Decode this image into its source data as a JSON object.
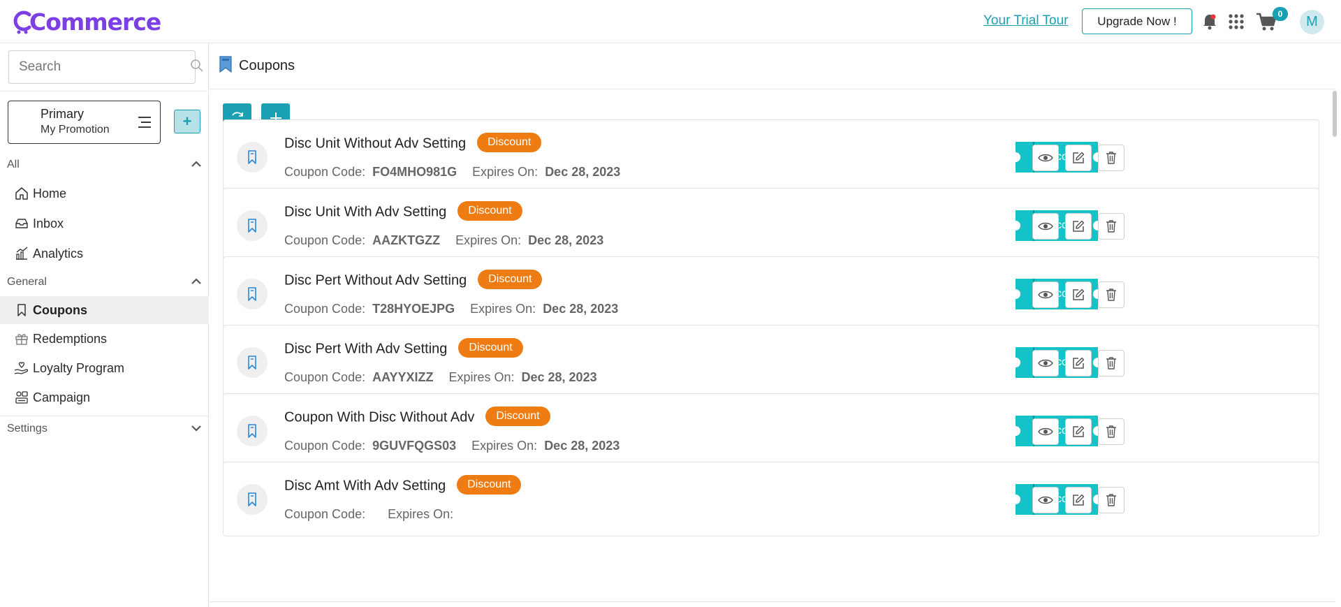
{
  "header": {
    "brand": "Commerce",
    "trial_link": "Your Trial Tour",
    "upgrade_label": "Upgrade Now !",
    "cart_count": "0",
    "avatar_initial": "M",
    "accent_color": "#1a9fb3",
    "brand_color": "#7b3fe4"
  },
  "sidebar": {
    "search_placeholder": "Search",
    "promotion": {
      "title": "Primary",
      "subtitle": "My Promotion",
      "add_label": "+"
    },
    "groups": [
      {
        "label": "All",
        "items": [
          {
            "label": "Home",
            "icon": "home-icon"
          },
          {
            "label": "Inbox",
            "icon": "inbox-icon"
          },
          {
            "label": "Analytics",
            "icon": "analytics-icon"
          }
        ]
      },
      {
        "label": "General",
        "items": [
          {
            "label": "Coupons",
            "icon": "bookmark-icon",
            "active": true
          },
          {
            "label": "Redemptions",
            "icon": "gift-icon"
          },
          {
            "label": "Loyalty Program",
            "icon": "hand-heart-icon"
          },
          {
            "label": "Campaign",
            "icon": "campaign-icon"
          }
        ]
      },
      {
        "label": "Settings",
        "items": []
      }
    ]
  },
  "main": {
    "title": "Coupons",
    "coupons": [
      {
        "name": "Disc Unit Without Adv Setting",
        "badge": "Discount",
        "code_label": "Coupon Code:",
        "code": "FO4MHO981G",
        "expires_label": "Expires On:",
        "expires": "Dec 28, 2023",
        "ticket_label": "Discount"
      },
      {
        "name": "Disc Unit With Adv Setting",
        "badge": "Discount",
        "code_label": "Coupon Code:",
        "code": "AAZKTGZZ",
        "expires_label": "Expires On:",
        "expires": "Dec 28, 2023",
        "ticket_label": "Discount"
      },
      {
        "name": "Disc Pert Without Adv Setting",
        "badge": "Discount",
        "code_label": "Coupon Code:",
        "code": "T28HYOEJPG",
        "expires_label": "Expires On:",
        "expires": "Dec 28, 2023",
        "ticket_label": "Discount"
      },
      {
        "name": "Disc Pert With Adv Setting",
        "badge": "Discount",
        "code_label": "Coupon Code:",
        "code": "AAYYXIZZ",
        "expires_label": "Expires On:",
        "expires": "Dec 28, 2023",
        "ticket_label": "Discount"
      },
      {
        "name": "Coupon With Disc Without Adv",
        "badge": "Discount",
        "code_label": "Coupon Code:",
        "code": "9GUVFQGS03",
        "expires_label": "Expires On:",
        "expires": "Dec 28, 2023",
        "ticket_label": "Discount"
      },
      {
        "name": "Disc Amt With Adv Setting",
        "badge": "Discount",
        "code_label": "Coupon Code:",
        "code": "",
        "expires_label": "Expires On:",
        "expires": "",
        "ticket_label": "Discount"
      }
    ],
    "badge_color": "#ee7c12",
    "ticket_color": "#13c3c8"
  }
}
